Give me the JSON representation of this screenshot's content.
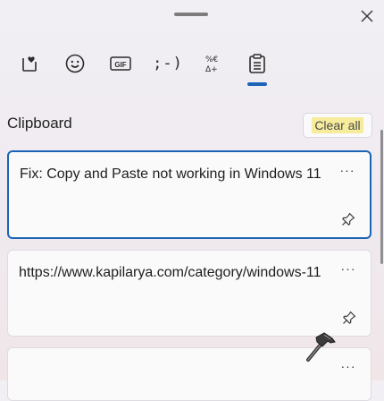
{
  "icons": {
    "close": "close-icon",
    "tabs": [
      "kaomoji-favorites-icon",
      "emoji-smiley-icon",
      "gif-icon",
      "kaomoji-icon",
      "symbols-icon",
      "clipboard-icon"
    ],
    "more": "more-icon",
    "pin": "pin-icon",
    "cursor": "hammer-cursor-icon"
  },
  "tabs": {
    "gif_label": "GIF",
    "kaomoji_label": ";-)",
    "symbols_label": "%€\nΔ+"
  },
  "clipboard": {
    "title": "Clipboard",
    "clear_all_label": "Clear all",
    "items": [
      {
        "text": "Fix: Copy and Paste not working in Windows 11",
        "selected": true
      },
      {
        "text": "https://www.kapilarya.com/category/windows-11",
        "selected": false
      },
      {
        "text": "",
        "selected": false
      }
    ],
    "more_label": "···"
  },
  "colors": {
    "accent": "#1a64b6",
    "highlight": "#f6ec9b"
  }
}
